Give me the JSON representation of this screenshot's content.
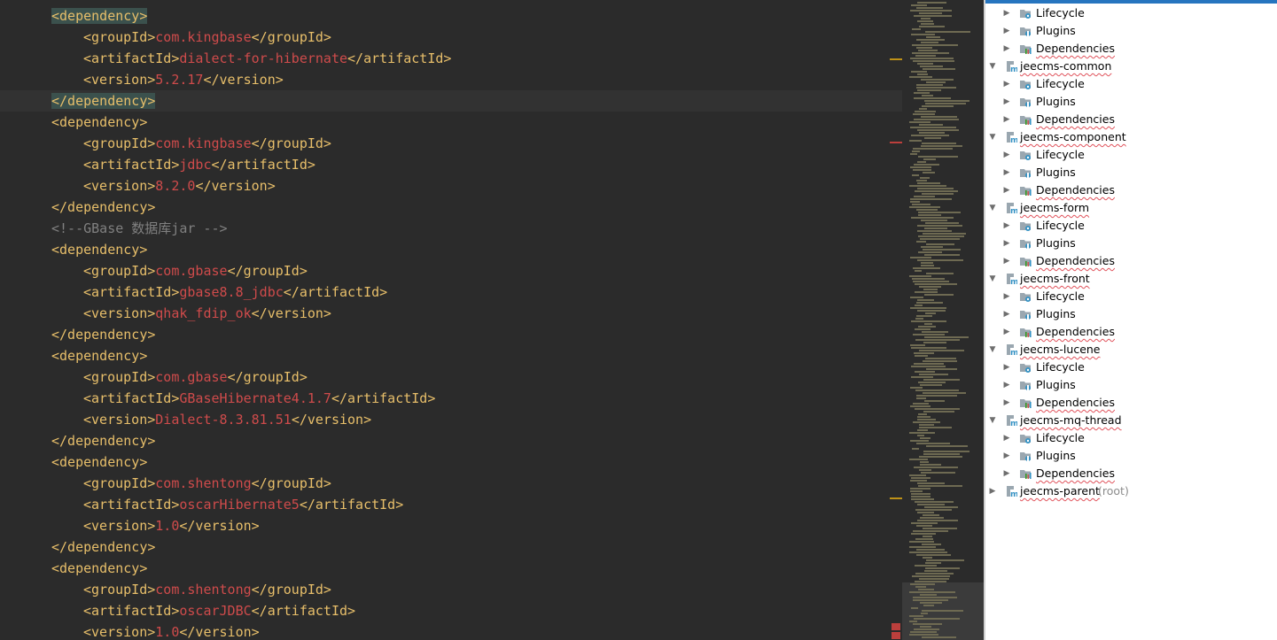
{
  "colors": {
    "editor_bg": "#2b2b2b",
    "tag": "#e8bf6a",
    "value": "#cf4b4b",
    "comment": "#808080",
    "text": "#a9b7c6",
    "highlight_tag_bg": "#3b514d",
    "panel_bg": "#ffffff",
    "selection": "#2675bf",
    "spell_underline": "#e0525b"
  },
  "editor": {
    "lines": [
      {
        "indent": 1,
        "parts": [
          {
            "t": "<dependency>",
            "c": "tag hl"
          }
        ]
      },
      {
        "indent": 2,
        "parts": [
          {
            "t": "<groupId>",
            "c": "tag"
          },
          {
            "t": "com.kingbase",
            "c": "val"
          },
          {
            "t": "</groupId>",
            "c": "tag"
          }
        ]
      },
      {
        "indent": 2,
        "parts": [
          {
            "t": "<artifactId>",
            "c": "tag"
          },
          {
            "t": "dialect-for-hibernate",
            "c": "val"
          },
          {
            "t": "</artifactId>",
            "c": "tag"
          }
        ]
      },
      {
        "indent": 2,
        "parts": [
          {
            "t": "<version>",
            "c": "tag"
          },
          {
            "t": "5.2.17",
            "c": "val"
          },
          {
            "t": "</version>",
            "c": "tag"
          }
        ]
      },
      {
        "indent": 1,
        "current": true,
        "parts": [
          {
            "t": "</dependency>",
            "c": "tag hl"
          }
        ]
      },
      {
        "indent": 1,
        "parts": [
          {
            "t": "<dependency>",
            "c": "tag"
          }
        ]
      },
      {
        "indent": 2,
        "parts": [
          {
            "t": "<groupId>",
            "c": "tag"
          },
          {
            "t": "com.kingbase",
            "c": "val"
          },
          {
            "t": "</groupId>",
            "c": "tag"
          }
        ]
      },
      {
        "indent": 2,
        "parts": [
          {
            "t": "<artifactId>",
            "c": "tag"
          },
          {
            "t": "jdbc",
            "c": "val"
          },
          {
            "t": "</artifactId>",
            "c": "tag"
          }
        ]
      },
      {
        "indent": 2,
        "parts": [
          {
            "t": "<version>",
            "c": "tag"
          },
          {
            "t": "8.2.0",
            "c": "val"
          },
          {
            "t": "</version>",
            "c": "tag"
          }
        ]
      },
      {
        "indent": 1,
        "parts": [
          {
            "t": "</dependency>",
            "c": "tag"
          }
        ]
      },
      {
        "indent": 1,
        "parts": [
          {
            "t": "<!--GBase 数据库jar -->",
            "c": "cmt"
          }
        ]
      },
      {
        "indent": 1,
        "parts": [
          {
            "t": "<dependency>",
            "c": "tag"
          }
        ]
      },
      {
        "indent": 2,
        "parts": [
          {
            "t": "<groupId>",
            "c": "tag"
          },
          {
            "t": "com.gbase",
            "c": "val"
          },
          {
            "t": "</groupId>",
            "c": "tag"
          }
        ]
      },
      {
        "indent": 2,
        "parts": [
          {
            "t": "<artifactId>",
            "c": "tag"
          },
          {
            "t": "gbase8.8_jdbc",
            "c": "val"
          },
          {
            "t": "</artifactId>",
            "c": "tag"
          }
        ]
      },
      {
        "indent": 2,
        "parts": [
          {
            "t": "<version>",
            "c": "tag"
          },
          {
            "t": "qhak_fdip_ok",
            "c": "val"
          },
          {
            "t": "</version>",
            "c": "tag"
          }
        ]
      },
      {
        "indent": 1,
        "parts": [
          {
            "t": "</dependency>",
            "c": "tag"
          }
        ]
      },
      {
        "indent": 1,
        "parts": [
          {
            "t": "<dependency>",
            "c": "tag"
          }
        ]
      },
      {
        "indent": 2,
        "parts": [
          {
            "t": "<groupId>",
            "c": "tag"
          },
          {
            "t": "com.gbase",
            "c": "val"
          },
          {
            "t": "</groupId>",
            "c": "tag"
          }
        ]
      },
      {
        "indent": 2,
        "parts": [
          {
            "t": "<artifactId>",
            "c": "tag"
          },
          {
            "t": "GBaseHibernate4.1.7",
            "c": "val"
          },
          {
            "t": "</artifactId>",
            "c": "tag"
          }
        ]
      },
      {
        "indent": 2,
        "parts": [
          {
            "t": "<version>",
            "c": "tag"
          },
          {
            "t": "Dialect-8.3.81.51",
            "c": "val"
          },
          {
            "t": "</version>",
            "c": "tag"
          }
        ]
      },
      {
        "indent": 1,
        "parts": [
          {
            "t": "</dependency>",
            "c": "tag"
          }
        ]
      },
      {
        "indent": 1,
        "parts": [
          {
            "t": "<dependency>",
            "c": "tag"
          }
        ]
      },
      {
        "indent": 2,
        "parts": [
          {
            "t": "<groupId>",
            "c": "tag"
          },
          {
            "t": "com.shentong",
            "c": "val"
          },
          {
            "t": "</groupId>",
            "c": "tag"
          }
        ]
      },
      {
        "indent": 2,
        "parts": [
          {
            "t": "<artifactId>",
            "c": "tag"
          },
          {
            "t": "oscarHibernate5",
            "c": "val"
          },
          {
            "t": "</artifactId>",
            "c": "tag"
          }
        ]
      },
      {
        "indent": 2,
        "parts": [
          {
            "t": "<version>",
            "c": "tag"
          },
          {
            "t": "1.0",
            "c": "val"
          },
          {
            "t": "</version>",
            "c": "tag"
          }
        ]
      },
      {
        "indent": 1,
        "parts": [
          {
            "t": "</dependency>",
            "c": "tag"
          }
        ]
      },
      {
        "indent": 1,
        "parts": [
          {
            "t": "<dependency>",
            "c": "tag"
          }
        ]
      },
      {
        "indent": 2,
        "parts": [
          {
            "t": "<groupId>",
            "c": "tag"
          },
          {
            "t": "com.shentong",
            "c": "val"
          },
          {
            "t": "</groupId>",
            "c": "tag"
          }
        ]
      },
      {
        "indent": 2,
        "parts": [
          {
            "t": "<artifactId>",
            "c": "tag"
          },
          {
            "t": "oscarJDBC",
            "c": "val"
          },
          {
            "t": "</artifactId>",
            "c": "tag"
          }
        ]
      },
      {
        "indent": 2,
        "parts": [
          {
            "t": "<version>",
            "c": "tag"
          },
          {
            "t": "1.0",
            "c": "val"
          },
          {
            "t": "</version>",
            "c": "tag"
          }
        ]
      }
    ]
  },
  "maven_tree": {
    "nodes": [
      {
        "kind": "child",
        "label": "Lifecycle",
        "icon": "lifecycle-icon"
      },
      {
        "kind": "child",
        "label": "Plugins",
        "icon": "plugins-icon"
      },
      {
        "kind": "child",
        "label": "Dependencies",
        "icon": "dependencies-icon"
      },
      {
        "kind": "module",
        "label": "jeecms-common",
        "icon": "maven-module-icon",
        "expanded": true
      },
      {
        "kind": "child",
        "label": "Lifecycle",
        "icon": "lifecycle-icon"
      },
      {
        "kind": "child",
        "label": "Plugins",
        "icon": "plugins-icon"
      },
      {
        "kind": "child",
        "label": "Dependencies",
        "icon": "dependencies-icon"
      },
      {
        "kind": "module",
        "label": "jeecms-component",
        "icon": "maven-module-icon",
        "expanded": true
      },
      {
        "kind": "child",
        "label": "Lifecycle",
        "icon": "lifecycle-icon"
      },
      {
        "kind": "child",
        "label": "Plugins",
        "icon": "plugins-icon"
      },
      {
        "kind": "child",
        "label": "Dependencies",
        "icon": "dependencies-icon"
      },
      {
        "kind": "module",
        "label": "jeecms-form",
        "icon": "maven-module-icon",
        "expanded": true
      },
      {
        "kind": "child",
        "label": "Lifecycle",
        "icon": "lifecycle-icon"
      },
      {
        "kind": "child",
        "label": "Plugins",
        "icon": "plugins-icon"
      },
      {
        "kind": "child",
        "label": "Dependencies",
        "icon": "dependencies-icon"
      },
      {
        "kind": "module",
        "label": "jeecms-front",
        "icon": "maven-module-icon",
        "expanded": true
      },
      {
        "kind": "child",
        "label": "Lifecycle",
        "icon": "lifecycle-icon"
      },
      {
        "kind": "child",
        "label": "Plugins",
        "icon": "plugins-icon"
      },
      {
        "kind": "child",
        "label": "Dependencies",
        "icon": "dependencies-icon"
      },
      {
        "kind": "module",
        "label": "jeecms-lucene",
        "icon": "maven-module-icon",
        "expanded": true
      },
      {
        "kind": "child",
        "label": "Lifecycle",
        "icon": "lifecycle-icon"
      },
      {
        "kind": "child",
        "label": "Plugins",
        "icon": "plugins-icon"
      },
      {
        "kind": "child",
        "label": "Dependencies",
        "icon": "dependencies-icon"
      },
      {
        "kind": "module",
        "label": "jeecms-mq-thread",
        "icon": "maven-module-icon",
        "expanded": true
      },
      {
        "kind": "child",
        "label": "Lifecycle",
        "icon": "lifecycle-icon"
      },
      {
        "kind": "child",
        "label": "Plugins",
        "icon": "plugins-icon"
      },
      {
        "kind": "child",
        "label": "Dependencies",
        "icon": "dependencies-icon"
      },
      {
        "kind": "module",
        "label": "jeecms-parent",
        "suffix": "(root)",
        "icon": "maven-module-icon",
        "expanded": false
      }
    ]
  }
}
